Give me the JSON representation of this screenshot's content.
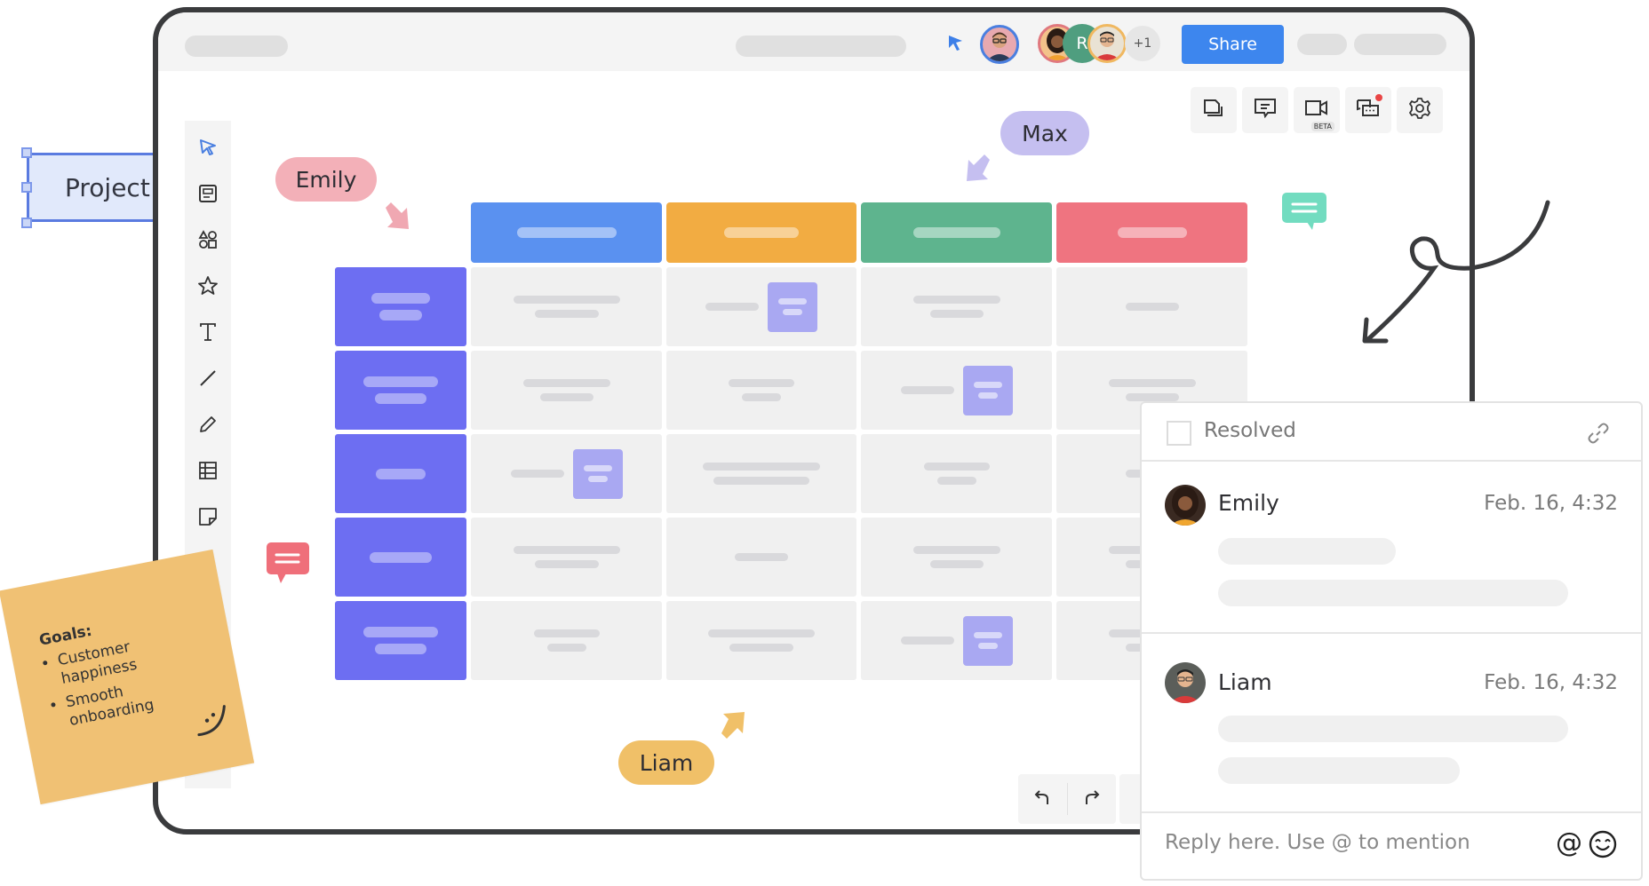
{
  "topbar": {
    "share_label": "Share",
    "collaborators": [
      {
        "name": "Emily",
        "ring": "#e0787e",
        "bg": "#6b4636"
      },
      {
        "name": "R",
        "initial": "R",
        "bg": "#4f9e7f"
      },
      {
        "name": "Liam",
        "ring": "#f0b860",
        "bg": "#d44040"
      }
    ],
    "current_user_ring": "#4a7fe0",
    "extra_count": "+1"
  },
  "toolbar_right": {
    "items": [
      {
        "name": "pages",
        "icon": "copy-icon"
      },
      {
        "name": "comments",
        "icon": "comment-icon"
      },
      {
        "name": "video",
        "icon": "video-icon",
        "badge": "BETA"
      },
      {
        "name": "chat",
        "icon": "chat-icon",
        "notification": true
      },
      {
        "name": "settings",
        "icon": "gear-icon"
      }
    ]
  },
  "toolbar_left": {
    "items": [
      {
        "name": "select",
        "icon": "cursor-icon"
      },
      {
        "name": "template",
        "icon": "template-icon"
      },
      {
        "name": "shapes",
        "icon": "shapes-icon"
      },
      {
        "name": "star",
        "icon": "star-icon"
      },
      {
        "name": "text",
        "icon": "text-icon"
      },
      {
        "name": "line",
        "icon": "line-icon"
      },
      {
        "name": "pen",
        "icon": "pen-icon"
      },
      {
        "name": "table",
        "icon": "table-icon"
      },
      {
        "name": "sticky-note",
        "icon": "sticky-note-icon"
      }
    ]
  },
  "canvas": {
    "project_label": "Project",
    "cursor_labels": [
      {
        "name": "Emily",
        "color": "#f3b0b8"
      },
      {
        "name": "Max",
        "color": "#c5bff0"
      },
      {
        "name": "Liam",
        "color": "#f0c068"
      }
    ],
    "grid": {
      "column_colors": [
        "#5a91f0",
        "#f2ac42",
        "#5eb48e",
        "#ef7480"
      ],
      "row_header_color": "#6d6ef2",
      "rows": 5,
      "columns": 4
    },
    "sticky_note": {
      "title": "Goals:",
      "bullets": [
        "Customer happiness",
        "Smooth onboarding"
      ],
      "color": "#f0c174"
    }
  },
  "undo_redo": {
    "undo": "undo-icon",
    "redo": "redo-icon"
  },
  "comment_panel": {
    "resolved_label": "Resolved",
    "comments": [
      {
        "author": "Emily",
        "time": "Feb. 16, 4:32"
      },
      {
        "author": "Liam",
        "time": "Feb. 16, 4:32"
      }
    ],
    "reply_placeholder": "Reply here. Use @ to mention"
  }
}
